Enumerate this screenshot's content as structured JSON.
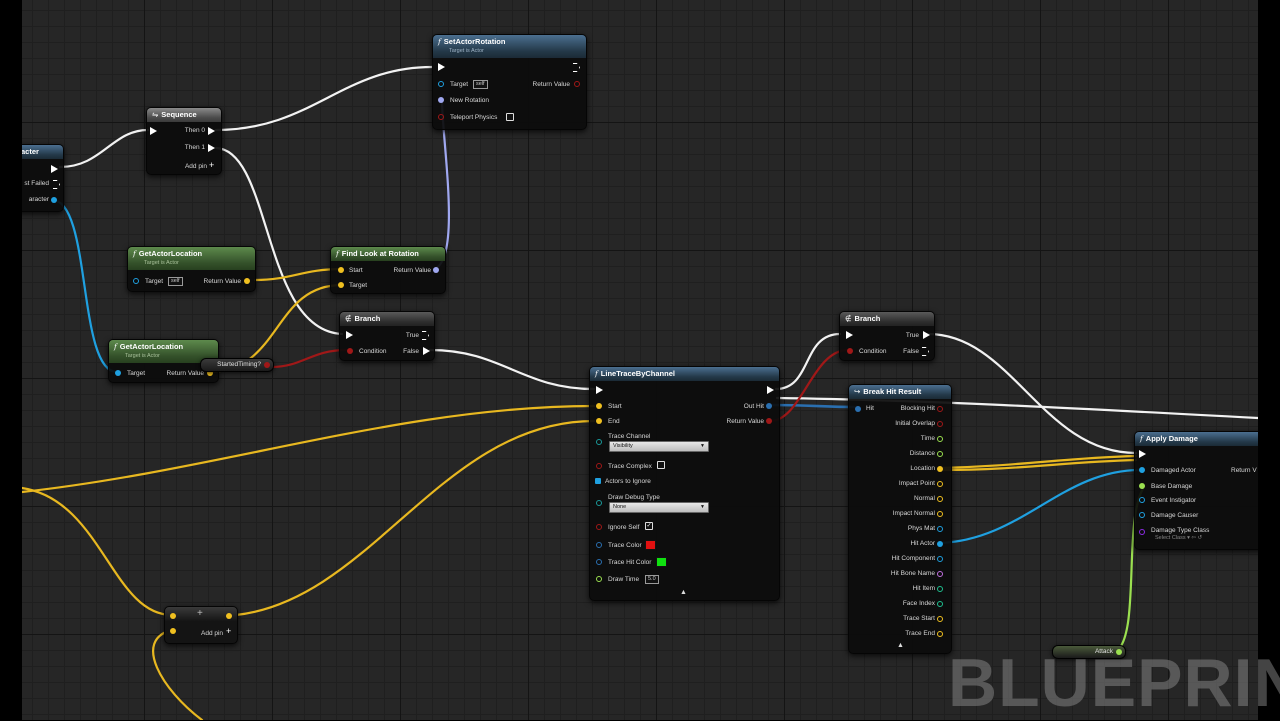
{
  "colors": {
    "exec": "#ffffff",
    "vector": "#f0c020",
    "object": "#1fa0e0",
    "bool": "#8c1010",
    "float": "#9be050",
    "rotator": "#a0a8f0",
    "struct": "#2a6fb0",
    "node_blue": "#2f4a61",
    "node_green": "#3b5a2f"
  },
  "nodes": {
    "cast_partial": {
      "title": "acter",
      "pin_failed": "st Failed",
      "pin_character": "aracter"
    },
    "sequence": {
      "title": "Sequence",
      "icon": "sequence-icon",
      "then0": "Then 0",
      "then1": "Then 1",
      "addpin": "Add pin"
    },
    "set_actor_rotation": {
      "title": "SetActorRotation",
      "subtitle": "Target is Actor",
      "target": "Target",
      "target_value": "self",
      "return_value": "Return Value",
      "new_rotation": "New Rotation",
      "teleport": "Teleport Physics"
    },
    "get_actor_location_1": {
      "title": "GetActorLocation",
      "subtitle": "Target is Actor",
      "target": "Target",
      "target_value": "self",
      "return_value": "Return Value"
    },
    "get_actor_location_2": {
      "title": "GetActorLocation",
      "subtitle": "Target is Actor",
      "target": "Target",
      "return_value": "Return Value"
    },
    "find_look_at": {
      "title": "Find Look at Rotation",
      "start": "Start",
      "target": "Target",
      "return_value": "Return Value"
    },
    "branch1": {
      "title": "Branch",
      "true_label": "True",
      "condition": "Condition",
      "false_label": "False"
    },
    "started_timing": {
      "label": "StartedTiming?"
    },
    "line_trace": {
      "title": "LineTraceByChannel",
      "start": "Start",
      "end": "End",
      "out_hit": "Out Hit",
      "return_value": "Return Value",
      "trace_channel": "Trace Channel",
      "trace_channel_value": "Visibility",
      "trace_complex": "Trace Complex",
      "actors_to_ignore": "Actors to Ignore",
      "draw_debug_type": "Draw Debug Type",
      "draw_debug_value": "None",
      "ignore_self": "Ignore Self",
      "trace_color": "Trace Color",
      "trace_hit_color": "Trace Hit Color",
      "draw_time": "Draw Time",
      "draw_time_value": "5.0",
      "trace_color_hex": "#e01010",
      "trace_hit_color_hex": "#10e010"
    },
    "branch2": {
      "title": "Branch",
      "true_label": "True",
      "condition": "Condition",
      "false_label": "False"
    },
    "break_hit": {
      "title": "Break Hit Result",
      "hit": "Hit",
      "outputs": [
        "Blocking Hit",
        "Initial Overlap",
        "Time",
        "Distance",
        "Location",
        "Impact Point",
        "Normal",
        "Impact Normal",
        "Phys Mat",
        "Hit Actor",
        "Hit Component",
        "Hit Bone Name",
        "Hit Item",
        "Face Index",
        "Trace Start",
        "Trace End"
      ]
    },
    "apply_damage": {
      "title": "Apply Damage",
      "damaged_actor": "Damaged Actor",
      "return_value": "Return V",
      "base_damage": "Base Damage",
      "event_instigator": "Event Instigator",
      "damage_causer": "Damage Causer",
      "damage_type_class": "Damage Type Class",
      "select_class": "Select Class"
    },
    "attack_var": {
      "label": "Attack"
    },
    "add_vector": {
      "addpin": "Add pin"
    }
  },
  "watermark": "BLUEPRIN"
}
